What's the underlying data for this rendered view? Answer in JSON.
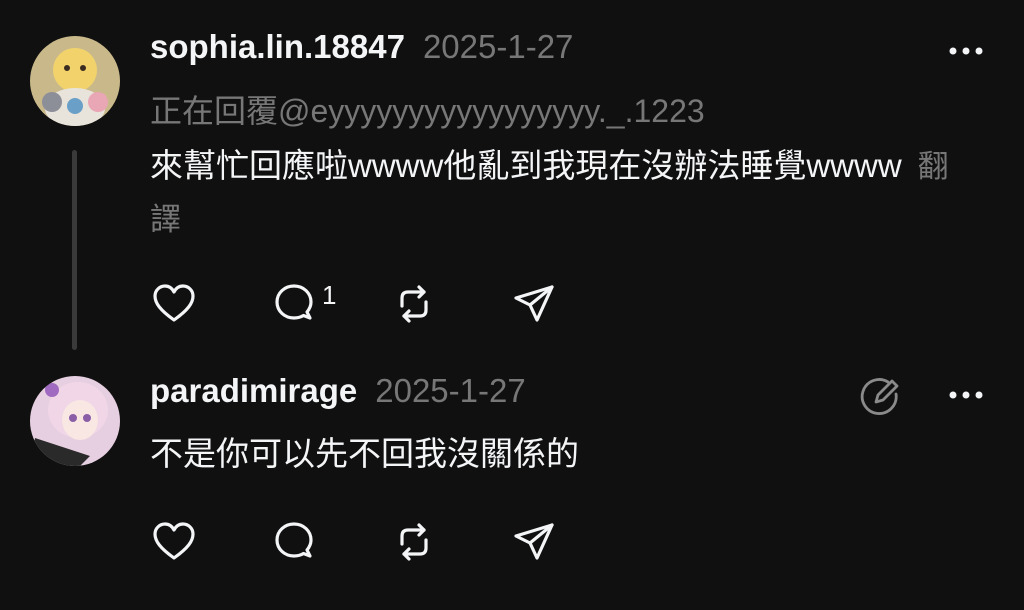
{
  "posts": [
    {
      "username": "sophia.lin.18847",
      "timestamp": "2025-1-27",
      "reply_to": "正在回覆@eyyyyyyyyyyyyyyyyy._.1223",
      "text": "來幫忙回應啦wwww他亂到我現在沒辦法睡覺wwww",
      "translate_label": "翻譯",
      "reply_count": "1"
    },
    {
      "username": "paradimirage",
      "timestamp": "2025-1-27",
      "text": "不是你可以先不回我沒關係的"
    }
  ],
  "colors": {
    "background": "#101010",
    "text": "#f3f5f7",
    "secondary": "#777777",
    "thread_line": "#3a3a3a"
  },
  "icons": [
    "heart-icon",
    "comment-icon",
    "repost-icon",
    "share-icon",
    "more-icon",
    "edit-icon"
  ]
}
